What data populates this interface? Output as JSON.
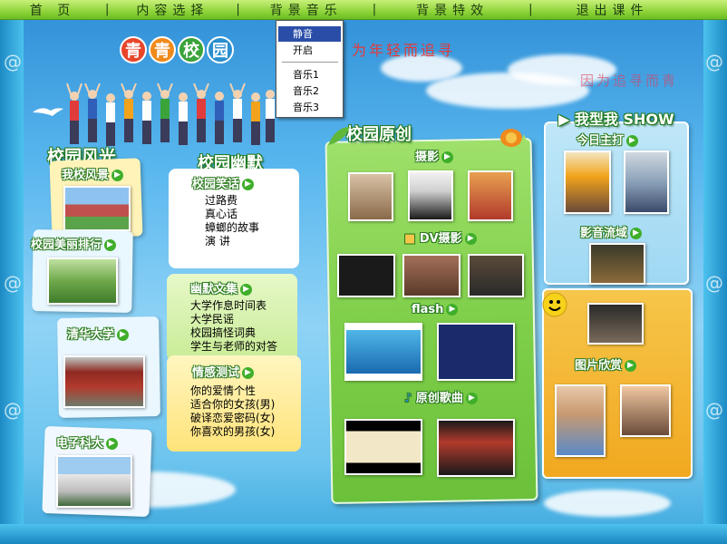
{
  "nav": {
    "items": [
      "首 页",
      "内容选择",
      "背景音乐",
      "背景特效",
      "退出课件"
    ],
    "separator": "|"
  },
  "music_menu": {
    "items": [
      "静音",
      "开启",
      "音乐1",
      "音乐2",
      "音乐3"
    ],
    "selected": "静音"
  },
  "header": {
    "logo_chars": [
      "青",
      "青",
      "校",
      "园"
    ],
    "logo_colors": [
      "#e8452b",
      "#f08a1c",
      "#3aa33a",
      "#2a8fd0"
    ],
    "slogan": "为年轻而追寻",
    "slogan2": "因为追寻而青"
  },
  "campus_scenery": {
    "title": "校园风光",
    "items": [
      "我校风景",
      "校园美丽排行",
      "清华大学",
      "电子科大"
    ]
  },
  "campus_humor": {
    "title": "校园幽默",
    "jokes": {
      "heading": "校园笑话",
      "items": [
        "过路费",
        "真心话",
        "蟑螂的故事",
        "演  讲"
      ]
    },
    "writings": {
      "heading": "幽默文集",
      "items": [
        "大学作息时间表",
        "大学民谣",
        "校园搞怪词典",
        "学生与老师的对答"
      ]
    },
    "tests": {
      "heading": "情感测试",
      "items": [
        "你的爱情个性",
        "适合你的女孩(男)",
        "破译恋爱密码(女)",
        "你喜欢的男孩(女)"
      ]
    }
  },
  "campus_original": {
    "title": "校园原创",
    "sections": [
      "摄影",
      "DV摄影",
      "flash",
      "原创歌曲"
    ]
  },
  "show": {
    "title": "我型我 SHOW",
    "sections": [
      "今日主打",
      "影音流域",
      "图片欣赏"
    ]
  }
}
